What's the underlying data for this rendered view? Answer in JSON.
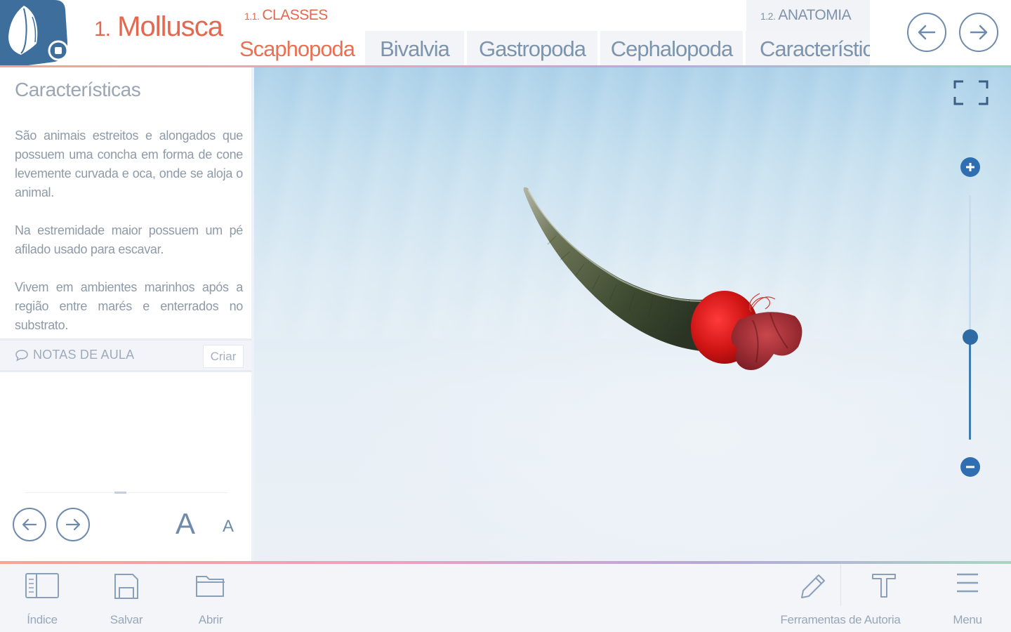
{
  "header": {
    "chapter_number": "1.",
    "chapter_title": "Mollusca",
    "classes_number": "1.1.",
    "classes_label": "CLASSES",
    "anatomia_number": "1.2.",
    "anatomia_label": "ANATOMIA",
    "tabs": [
      {
        "label": "Scaphopoda",
        "active": true
      },
      {
        "label": "Bivalvia",
        "active": false
      },
      {
        "label": "Gastropoda",
        "active": false
      },
      {
        "label": "Cephalopoda",
        "active": false
      },
      {
        "label": "Característic",
        "active": false
      }
    ],
    "nav": {
      "prev_icon": "arrow-left-icon",
      "next_icon": "arrow-right-icon"
    }
  },
  "sidebar": {
    "title": "Características",
    "paragraphs": [
      "São animais estreitos e alongados que possuem uma concha em forma de cone levemente curvada e oca, onde se aloja o animal.",
      "Na estremidade maior possuem um pé afilado usado para escavar.",
      "Vivem em ambientes marinhos após a região entre marés e enterrados no substrato."
    ],
    "notes_label": "NOTAS DE AULA",
    "notes_create": "Criar",
    "font_bigger": "A",
    "font_smaller": "A",
    "scroll_position": 0.47
  },
  "viewer": {
    "zoom_level": 0.42,
    "fullscreen_icon": "fullscreen-icon",
    "zoom_in_icon": "plus-icon",
    "zoom_out_icon": "minus-icon"
  },
  "toolbar": {
    "indice": "Índice",
    "salvar": "Salvar",
    "abrir": "Abrir",
    "autoria": "Ferramentas de Autoria",
    "menu": "Menu"
  },
  "colors": {
    "accent_orange": "#e2694f",
    "accent_blue": "#2f6eb0",
    "icon_gray": "#6f8bab"
  }
}
